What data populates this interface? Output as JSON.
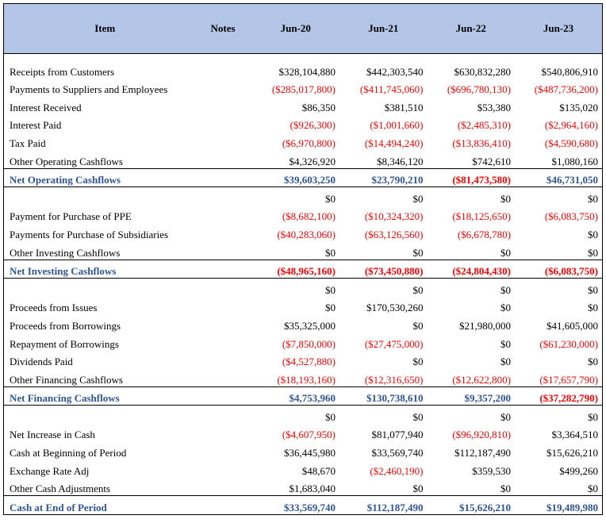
{
  "header": {
    "item": "Item",
    "notes": "Notes",
    "periods": [
      "Jun-20",
      "Jun-21",
      "Jun-22",
      "Jun-23"
    ]
  },
  "operating": {
    "rows": [
      {
        "label": "Receipts from Customers",
        "values": [
          "$328,104,880",
          "$442,303,540",
          "$630,832,280",
          "$540,806,910"
        ]
      },
      {
        "label": "Payments to Suppliers and Employees",
        "values": [
          "($285,017,800)",
          "($411,745,060)",
          "($696,780,130)",
          "($487,736,200)"
        ]
      },
      {
        "label": "Interest Received",
        "values": [
          "$86,350",
          "$381,510",
          "$53,380",
          "$135,020"
        ]
      },
      {
        "label": "Interest Paid",
        "values": [
          "($926,300)",
          "($1,001,660)",
          "($2,485,310)",
          "($2,964,160)"
        ]
      },
      {
        "label": "Tax Paid",
        "values": [
          "($6,970,800)",
          "($14,494,240)",
          "($13,836,410)",
          "($4,590,680)"
        ]
      },
      {
        "label": "Other Operating Cashflows",
        "values": [
          "$4,326,920",
          "$8,346,120",
          "$742,610",
          "$1,080,160"
        ]
      }
    ],
    "total": {
      "label": "Net Operating Cashflows",
      "values": [
        "$39,603,250",
        "$23,790,210",
        "($81,473,580)",
        "$46,731,050"
      ]
    }
  },
  "investing": {
    "lead": [
      "$0",
      "$0",
      "$0",
      "$0"
    ],
    "rows": [
      {
        "label": "Payment for Purchase of PPE",
        "values": [
          "($8,682,100)",
          "($10,324,320)",
          "($18,125,650)",
          "($6,083,750)"
        ]
      },
      {
        "label": "Payments for Purchase of Subsidiaries",
        "values": [
          "($40,283,060)",
          "($63,126,560)",
          "($6,678,780)",
          "$0"
        ]
      },
      {
        "label": "Other Investing Cashflows",
        "values": [
          "$0",
          "$0",
          "$0",
          "$0"
        ]
      }
    ],
    "total": {
      "label": "Net Investing Cashflows",
      "values": [
        "($48,965,160)",
        "($73,450,880)",
        "($24,804,430)",
        "($6,083,750)"
      ]
    }
  },
  "financing": {
    "lead": [
      "$0",
      "$0",
      "$0",
      "$0"
    ],
    "rows": [
      {
        "label": "Proceeds from Issues",
        "values": [
          "$0",
          "$170,530,260",
          "$0",
          "$0"
        ]
      },
      {
        "label": "Proceeds from Borrowings",
        "values": [
          "$35,325,000",
          "$0",
          "$21,980,000",
          "$41,605,000"
        ]
      },
      {
        "label": "Repayment of Borrowings",
        "values": [
          "($7,850,000)",
          "($27,475,000)",
          "$0",
          "($61,230,000)"
        ]
      },
      {
        "label": "Dividends Paid",
        "values": [
          "($4,527,880)",
          "$0",
          "$0",
          "$0"
        ]
      },
      {
        "label": "Other Financing Cashflows",
        "values": [
          "($18,193,160)",
          "($12,316,650)",
          "($12,622,800)",
          "($17,657,790)"
        ]
      }
    ],
    "total": {
      "label": "Net Financing Cashflows",
      "values": [
        "$4,753,960",
        "$130,738,610",
        "$9,357,200",
        "($37,282,790)"
      ]
    }
  },
  "cash": {
    "lead": [
      "$0",
      "$0",
      "$0",
      "$0"
    ],
    "rows": [
      {
        "label": "Net Increase in Cash",
        "values": [
          "($4,607,950)",
          "$81,077,940",
          "($96,920,810)",
          "$3,364,510"
        ]
      },
      {
        "label": "Cash at Beginning of Period",
        "values": [
          "$36,445,980",
          "$33,569,740",
          "$112,187,490",
          "$15,626,210"
        ]
      },
      {
        "label": "Exchange Rate Adj",
        "values": [
          "$48,670",
          "($2,460,190)",
          "$359,530",
          "$499,260"
        ]
      },
      {
        "label": "Other Cash Adjustments",
        "values": [
          "$1,683,040",
          "$0",
          "$0",
          "$0"
        ]
      }
    ],
    "total": {
      "label": "Cash at End of Period",
      "values": [
        "$33,569,740",
        "$112,187,490",
        "$15,626,210",
        "$19,489,980"
      ]
    }
  },
  "colors": {
    "header_bg": "#b4c6e7",
    "total_text": "#2f5597",
    "negative_text": "#ff0000"
  }
}
